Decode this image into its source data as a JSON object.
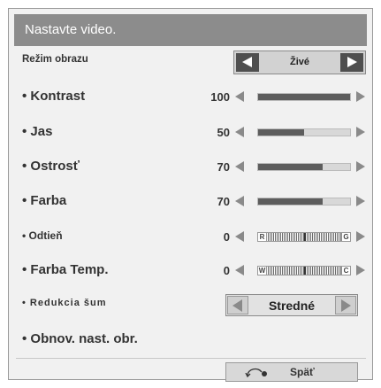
{
  "title": "Nastavte video.",
  "picture_mode": {
    "label": "Režim obrazu",
    "value": "Živé"
  },
  "sliders": [
    {
      "label": "• Kontrast",
      "value": "100",
      "level": 1.0
    },
    {
      "label": "• Jas",
      "value": "50",
      "level": 0.5
    },
    {
      "label": "• Ostrosť",
      "value": "70",
      "level": 0.7
    },
    {
      "label": "• Farba",
      "value": "70",
      "level": 0.7
    }
  ],
  "balance": [
    {
      "label": "• Odtieň",
      "value": "0",
      "left_cap": "R",
      "right_cap": "G"
    },
    {
      "label": "• Farba Temp.",
      "value": "0",
      "left_cap": "W",
      "right_cap": "C"
    }
  ],
  "noise_reduction": {
    "label": "• Redukcia šum",
    "value": "Stredné"
  },
  "reset": {
    "label": "• Obnov. nast. obr."
  },
  "back": {
    "label": "Späť"
  }
}
